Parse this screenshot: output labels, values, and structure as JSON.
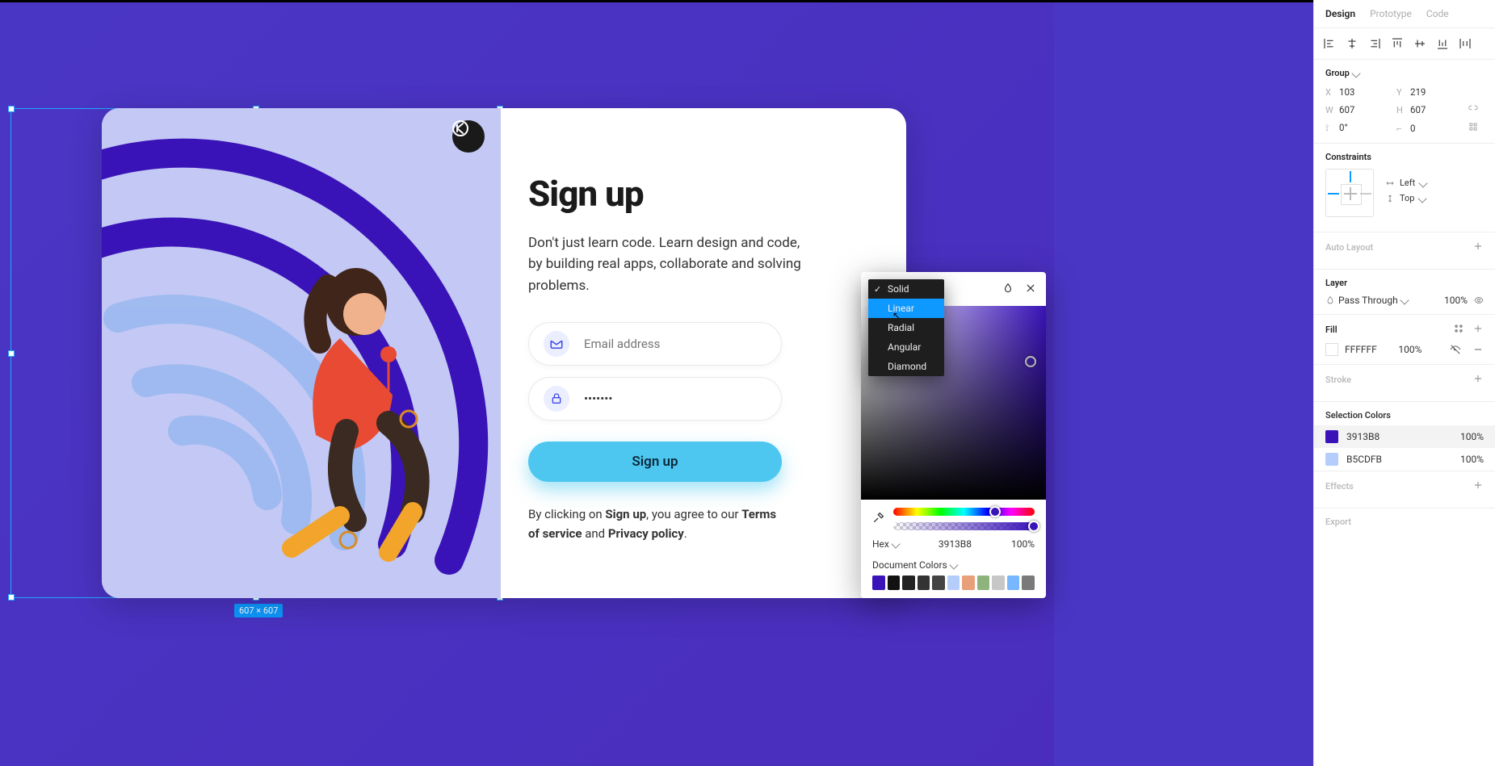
{
  "tabs": {
    "design": "Design",
    "prototype": "Prototype",
    "code": "Code"
  },
  "group": {
    "label": "Group",
    "x_label": "X",
    "x": "103",
    "y_label": "Y",
    "y": "219",
    "w_label": "W",
    "w": "607",
    "h_label": "H",
    "h": "607",
    "rot_label": "",
    "rot": "0°",
    "corner_label": "",
    "corner": "0"
  },
  "constraints": {
    "title": "Constraints",
    "h": "Left",
    "v": "Top"
  },
  "auto_layout": {
    "title": "Auto Layout"
  },
  "layer": {
    "title": "Layer",
    "mode": "Pass Through",
    "opacity": "100%"
  },
  "fill": {
    "title": "Fill",
    "hex": "FFFFFF",
    "opacity": "100%"
  },
  "stroke": {
    "title": "Stroke"
  },
  "selection_colors": {
    "title": "Selection Colors",
    "items": [
      {
        "hex": "3913B8",
        "opacity": "100%",
        "color": "#3913B8"
      },
      {
        "hex": "B5CDFB",
        "opacity": "100%",
        "color": "#B5CDFB"
      }
    ]
  },
  "effects": {
    "title": "Effects"
  },
  "export": {
    "title": "Export"
  },
  "picker": {
    "types": [
      "Solid",
      "Linear",
      "Radial",
      "Angular",
      "Diamond"
    ],
    "checked": "Solid",
    "hover": "Linear",
    "hex_label": "Hex",
    "hex": "3913B8",
    "alpha": "100%",
    "doc_label": "Document Colors",
    "doc_swatches": [
      "#3913b8",
      "#111",
      "#222",
      "#333",
      "#444",
      "#b5cdfb",
      "#e8a07a",
      "#8fb37d",
      "#c7c7c7",
      "#78b6ff",
      "#7a7a7a"
    ]
  },
  "selection_badge": "607 × 607",
  "card": {
    "title": "Sign up",
    "desc": "Don't just learn code. Learn design and code, by building real apps, collaborate and solving problems.",
    "email_placeholder": "Email address",
    "password_value": "*******",
    "button": "Sign up",
    "terms_pre": "By clicking on ",
    "terms_signup": "Sign up",
    "terms_mid": ", you agree to our ",
    "terms_tos": "Terms of service",
    "terms_and": " and ",
    "terms_pp": "Privacy policy",
    "terms_dot": "."
  }
}
